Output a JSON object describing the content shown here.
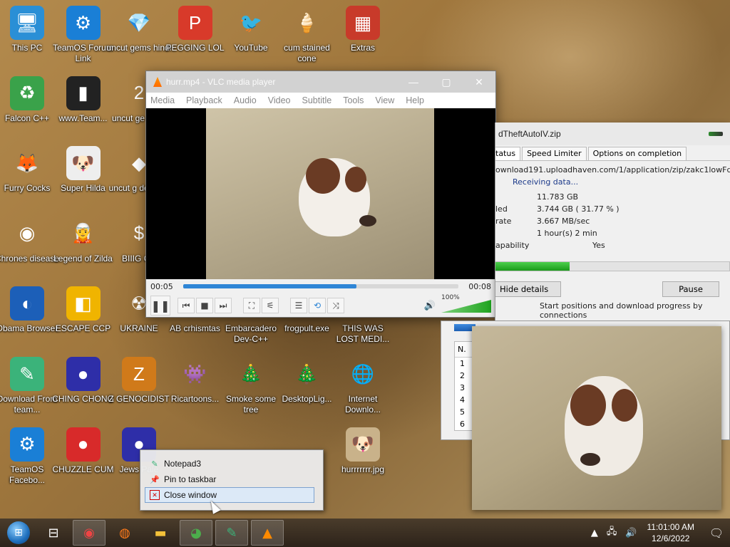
{
  "desktop": {
    "icons": [
      {
        "label": "This PC",
        "glyph": "🖥",
        "bg": "#2a8fd6"
      },
      {
        "label": "TeamOS Forum Link",
        "glyph": "⚙",
        "bg": "#1a7fd6"
      },
      {
        "label": "uncut gems hindi",
        "glyph": "💎",
        "bg": "transparent"
      },
      {
        "label": "PEGGING LOL",
        "glyph": "P",
        "bg": "#d83a2a"
      },
      {
        "label": "YouTube",
        "glyph": "🐦",
        "bg": "transparent"
      },
      {
        "label": "cum stained cone",
        "glyph": "🍦",
        "bg": "transparent"
      },
      {
        "label": "Extras",
        "glyph": "▦",
        "bg": "#c83a2a"
      },
      {
        "label": "Falcon C++",
        "glyph": "♻",
        "bg": "#3aa24a"
      },
      {
        "label": "www.Team...",
        "glyph": "▮",
        "bg": "#222"
      },
      {
        "label": "uncut ge bang",
        "glyph": "2",
        "bg": "transparent"
      },
      {
        "label": "Furry Cocks",
        "glyph": "🦊",
        "bg": "transparent"
      },
      {
        "label": "Super Hilda",
        "glyph": "🐶",
        "bg": "#eee"
      },
      {
        "label": "uncut g delete s",
        "glyph": "◆",
        "bg": "transparent"
      },
      {
        "label": "Chrones disease",
        "glyph": "◉",
        "bg": "transparent"
      },
      {
        "label": "Legend of Zilda",
        "glyph": "🧝",
        "bg": "transparent"
      },
      {
        "label": "BIIIG CU",
        "glyph": "$",
        "bg": "transparent"
      },
      {
        "label": "Obama Browser",
        "glyph": "◐",
        "bg": "#1c5fb8"
      },
      {
        "label": "ESCAPE CCP",
        "glyph": "◧",
        "bg": "#f0b400"
      },
      {
        "label": "UKRAINE",
        "glyph": "☢",
        "bg": "transparent"
      },
      {
        "label": "AB crhismtas",
        "glyph": "",
        "bg": "transparent"
      },
      {
        "label": "Embarcadero Dev-C++",
        "glyph": "",
        "bg": "transparent"
      },
      {
        "label": "frogpult.exe",
        "glyph": "",
        "bg": "transparent"
      },
      {
        "label": "THIS WAS LOST MEDI...",
        "glyph": "",
        "bg": "transparent"
      },
      {
        "label": "Download From team...",
        "glyph": "✎",
        "bg": "#3bb37a"
      },
      {
        "label": "CHING CHONG",
        "glyph": "●",
        "bg": "#2e2ea8"
      },
      {
        "label": "Z GENOCIDIST",
        "glyph": "Z",
        "bg": "#d07a1a"
      },
      {
        "label": "Ricartoons...",
        "glyph": "👾",
        "bg": "transparent"
      },
      {
        "label": "Smoke some tree",
        "glyph": "🎄",
        "bg": "transparent"
      },
      {
        "label": "DesktopLig...",
        "glyph": "🎄",
        "bg": "transparent"
      },
      {
        "label": "Internet Downlo...",
        "glyph": "🌐",
        "bg": "transparent"
      },
      {
        "label": "TeamOS Facebo...",
        "glyph": "⚙",
        "bg": "#1a7fd6"
      },
      {
        "label": "CHUZZLE CUM",
        "glyph": "●",
        "bg": "#d82a2a"
      },
      {
        "label": "Jews Pale",
        "glyph": "●",
        "bg": "#2e2ea8"
      },
      {
        "label": "hurrrrrrr.jpg",
        "glyph": "🐶",
        "bg": "#c9b28a"
      }
    ]
  },
  "vlc": {
    "title": "hurr.mp4 - VLC media player",
    "menu": [
      "Media",
      "Playback",
      "Audio",
      "Video",
      "Subtitle",
      "Tools",
      "View",
      "Help"
    ],
    "time_elapsed": "00:05",
    "time_total": "00:08",
    "progress": 0.63,
    "volume_label": "100%",
    "volume": 1.0
  },
  "idm": {
    "title": "dTheftAutoIV.zip",
    "tabs": [
      "tatus",
      "Speed Limiter",
      "Options on completion"
    ],
    "url": "ownload191.uploadhaven.com/1/application/zip/zakc1lowFqyKYiLwkr",
    "status_text": "Receiving data...",
    "rows": [
      {
        "key": "",
        "value": "11.783  GB"
      },
      {
        "key": "led",
        "value": "3.744  GB  ( 31.77 % )"
      },
      {
        "key": "rate",
        "value": "3.667  MB/sec"
      },
      {
        "key": "",
        "value": "1 hour(s) 2 min"
      },
      {
        "key": "apability",
        "value": "Yes"
      }
    ],
    "progress": 0.3177,
    "hide_details": "Hide details",
    "pause": "Pause",
    "connections_text": "Start positions and download progress by connections"
  },
  "connections": {
    "header": "N.",
    "rows": [
      "1",
      "2",
      "3",
      "4",
      "5",
      "6"
    ]
  },
  "jumplist": {
    "items": [
      {
        "label": "Notepad3",
        "glyph": "✎"
      },
      {
        "label": "Pin to taskbar",
        "glyph": "📌"
      },
      {
        "label": "Close window",
        "glyph": "✕"
      }
    ]
  },
  "taskbar": {
    "time": "11:01:00 AM",
    "date": "12/6/2022"
  }
}
